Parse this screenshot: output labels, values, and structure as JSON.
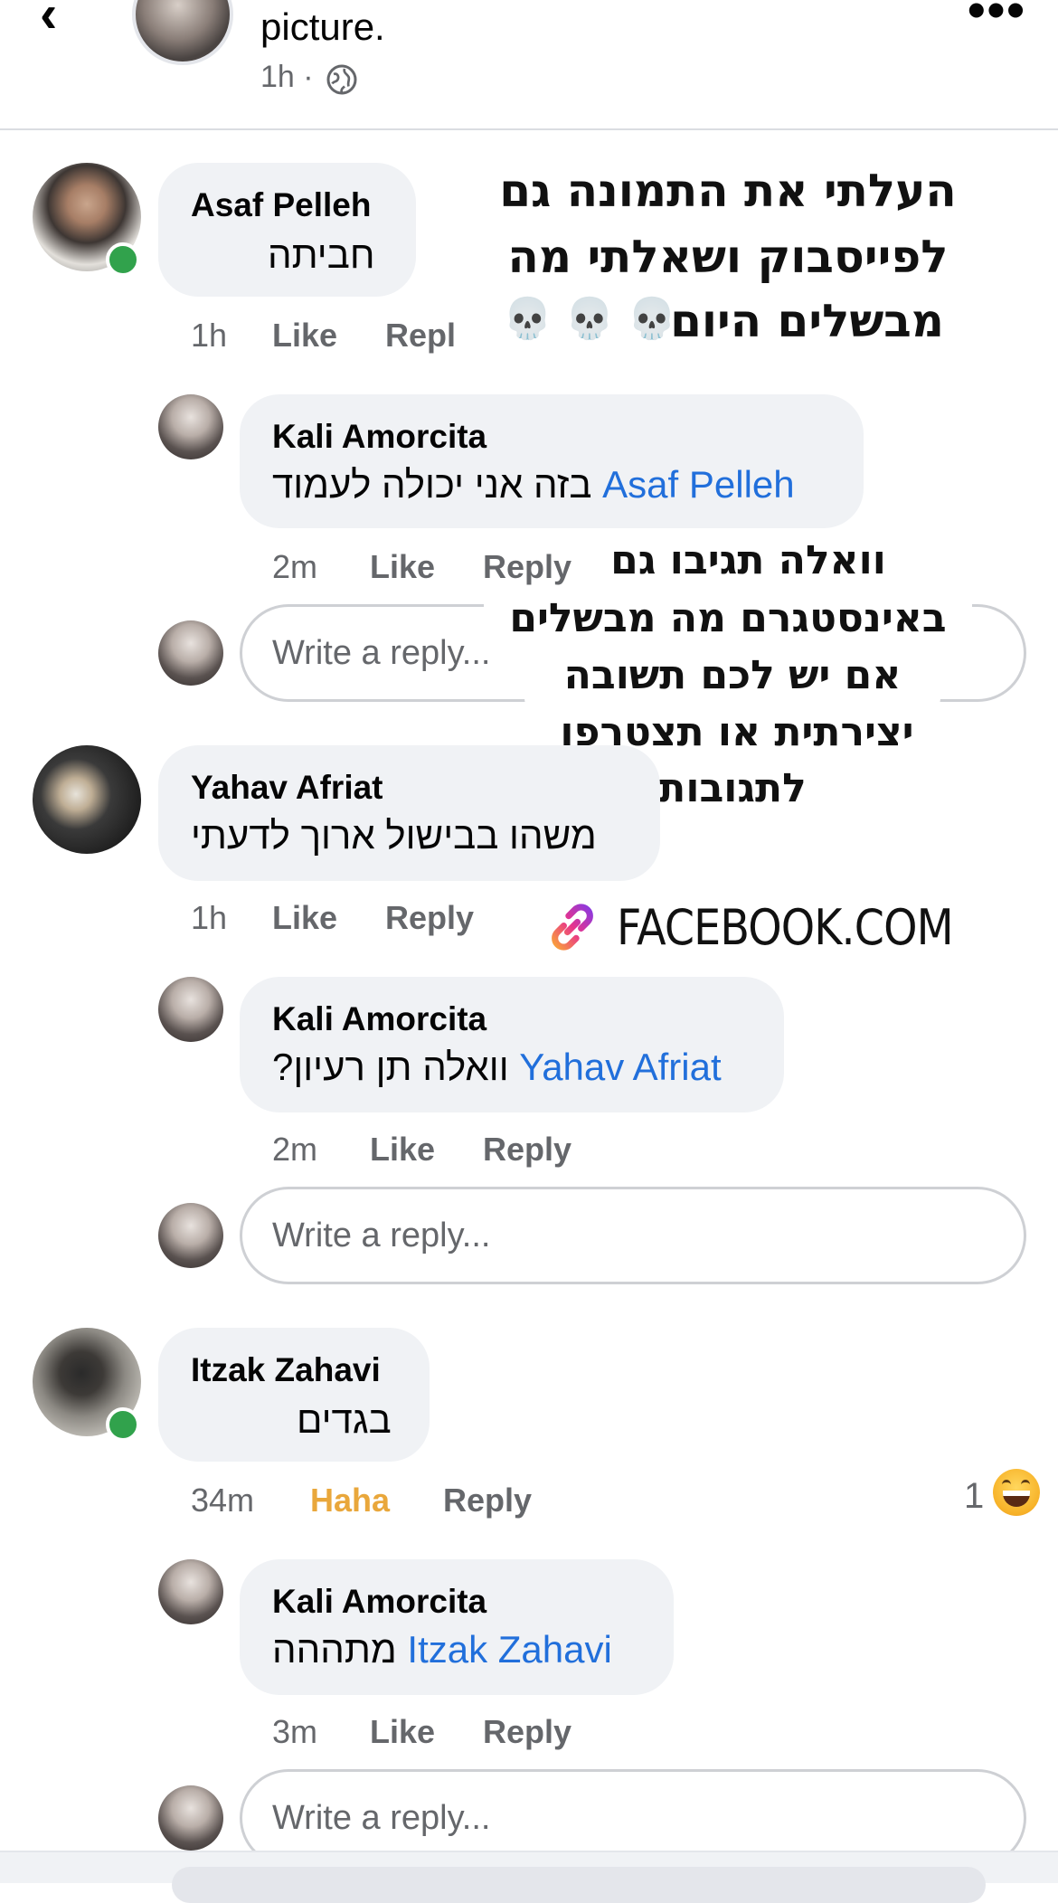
{
  "header": {
    "title": "picture.",
    "time": "1h ·",
    "back_icon": "chevron-left-icon",
    "more_icon": "more-horizontal-icon",
    "privacy_icon": "globe-icon"
  },
  "overlays": {
    "top_caption": [
      "העלתי את התמונה גם",
      "לפייסבוק ושאלתי מה",
      "מבשלים היום"
    ],
    "skulls": "💀💀💀",
    "middle_caption": [
      "וואלה תגיבו גם",
      "באינסטגרם מה מבשלים",
      "אם יש לכם תשובה",
      "יצירתית או תצטרפו",
      "לתגובות"
    ],
    "link_label": "FACEBOOK.COM",
    "link_icon": "link-icon"
  },
  "comments": [
    {
      "name": "Asaf Pelleh",
      "text": "חביתה",
      "time": "1h",
      "like": "Like",
      "reply": "Repl",
      "reply_comment": {
        "name": "Kali Amorcita",
        "mention": "Asaf Pelleh",
        "text": "בזה אני יכולה לעמוד",
        "time": "2m",
        "like": "Like",
        "reply": "Reply"
      },
      "reply_placeholder": "Write a reply..."
    },
    {
      "name": "Yahav Afriat",
      "text": "משהו בבישול ארוך לדעתי",
      "time": "1h",
      "like": "Like",
      "reply": "Reply",
      "reply_comment": {
        "name": "Kali Amorcita",
        "mention": "Yahav Afriat",
        "text": "וואלה תן רעיון?",
        "time": "2m",
        "like": "Like",
        "reply": "Reply"
      },
      "reply_placeholder": "Write a reply..."
    },
    {
      "name": "Itzak Zahavi",
      "text": "בגדים",
      "time": "34m",
      "like": "Haha",
      "reply": "Reply",
      "reaction_count": "1",
      "reaction_emoji": "😄",
      "reply_comment": {
        "name": "Kali Amorcita",
        "mention": "Itzak Zahavi",
        "text": "מתההה",
        "time": "3m",
        "like": "Like",
        "reply": "Reply"
      },
      "reply_placeholder": "Write a reply..."
    }
  ],
  "colors": {
    "mention": "#216fdb",
    "haha": "#e9a73b",
    "online": "#31a24c",
    "bubble": "#f0f2f5",
    "meta": "#65676b"
  }
}
